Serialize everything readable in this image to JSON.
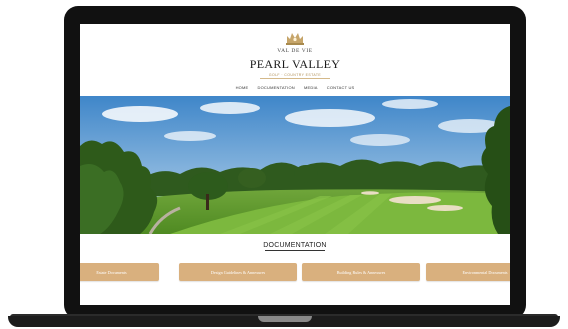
{
  "brand": {
    "top": "VAL DE VIE",
    "name": "PEARL VALLEY",
    "sub": "GOLF · COUNTRY ESTATE"
  },
  "nav": {
    "items": [
      "HOME",
      "DOCUMENTATION",
      "MEDIA",
      "CONTACT US"
    ]
  },
  "section": {
    "title": "DOCUMENTATION"
  },
  "documents": [
    {
      "label": "Estate Documents"
    },
    {
      "label": "Design Guidelines & Annexures"
    },
    {
      "label": "Building Rules & Annexures"
    },
    {
      "label": "Environmental Documents"
    }
  ],
  "colors": {
    "button": "#d9b07e",
    "gold": "#b08f55",
    "frame": "#111111"
  }
}
